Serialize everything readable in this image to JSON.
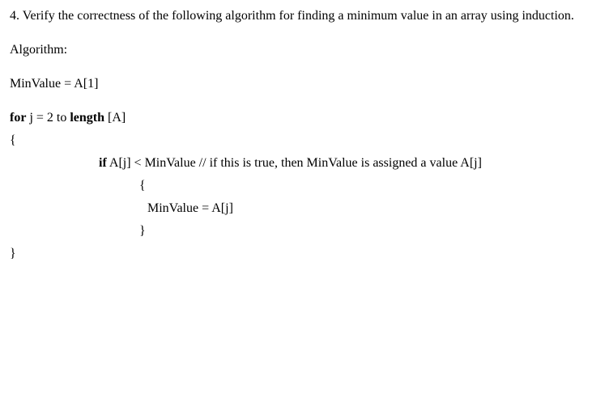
{
  "question": {
    "number": "4.",
    "text": "Verify the correctness of the following algorithm for finding a minimum value in an array using induction."
  },
  "algorithm": {
    "label": "Algorithm:",
    "init": "MinValue = A[1]",
    "for_kw": "for",
    "for_cond": " j = 2 to ",
    "length_kw": "length",
    "for_arr": " [A]",
    "open_brace": "{",
    "if_kw": "if",
    "if_cond": " A[j] < MinValue // if this is true, then MinValue is assigned a value A[j]",
    "inner_open": "{",
    "assign": "MinValue = A[j]",
    "inner_close": "}",
    "close_brace": "}"
  }
}
